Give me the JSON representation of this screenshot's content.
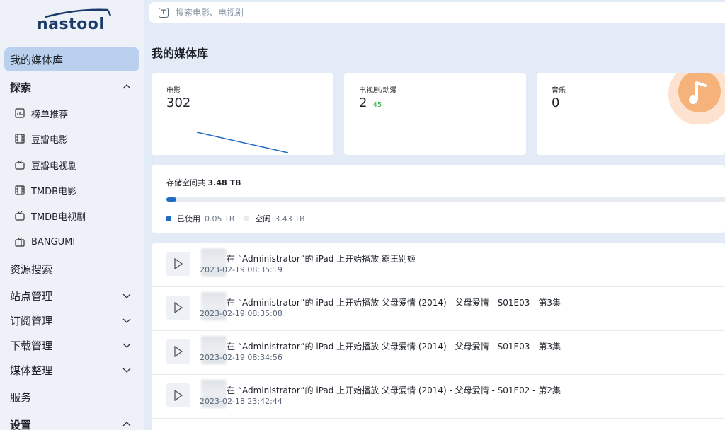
{
  "app": {
    "logo_text": "nastool"
  },
  "sidebar": {
    "items": [
      {
        "label": "我的媒体库",
        "active": true
      },
      {
        "label": "探索",
        "expanded": true
      },
      {
        "label": "资源搜索"
      },
      {
        "label": "站点管理"
      },
      {
        "label": "订阅管理"
      },
      {
        "label": "下载管理"
      },
      {
        "label": "媒体整理"
      },
      {
        "label": "服务"
      },
      {
        "label": "设置",
        "expanded": true
      }
    ],
    "explore_sub": [
      {
        "label": "榜单推荐",
        "icon": "chart-icon"
      },
      {
        "label": "豆瓣电影",
        "icon": "film-icon"
      },
      {
        "label": "豆瓣电视剧",
        "icon": "tv-icon"
      },
      {
        "label": "TMDB电影",
        "icon": "film-icon"
      },
      {
        "label": "TMDB电视剧",
        "icon": "tv-icon"
      },
      {
        "label": "BANGUMI",
        "icon": "tv-retro-icon"
      }
    ]
  },
  "search": {
    "placeholder": "搜索电影、电视剧",
    "icon_letter": "T"
  },
  "page": {
    "title": "我的媒体库"
  },
  "stats": {
    "movies": {
      "label": "电影",
      "value": "302"
    },
    "tv": {
      "label": "电视剧/动漫",
      "value": "2",
      "sub": "45"
    },
    "music": {
      "label": "音乐",
      "value": "0"
    }
  },
  "storage": {
    "title_prefix": "存储空间共",
    "total": "3.48 TB",
    "used_label": "已使用",
    "used": "0.05 TB",
    "free_label": "空闲",
    "free": "3.43 TB",
    "used_fraction": 0.0144,
    "colors": {
      "used": "#206bc4",
      "free": "#e8ebef"
    }
  },
  "activity": [
    {
      "title": "在 “Administrator”的 iPad 上开始播放 霸王别姬",
      "time": "2023-02-19 08:35:19"
    },
    {
      "title": "在 “Administrator”的 iPad 上开始播放 父母爱情 (2014) - 父母爱情 - S01E03 - 第3集",
      "time": "2023-02-19 08:35:08"
    },
    {
      "title": "在 “Administrator”的 iPad 上开始播放 父母爱情 (2014) - 父母爱情 - S01E03 - 第3集",
      "time": "2023-02-19 08:34:56"
    },
    {
      "title": "在 “Administrator”的 iPad 上开始播放 父母爱情 (2014) - 父母爱情 - S01E02 - 第2集",
      "time": "2023-02-18 23:42:44"
    }
  ],
  "colors": {
    "accent": "#206bc4",
    "active_nav": "#b9d0ee",
    "tv_sub": "#2fb344",
    "music_deco": "#f5b27a"
  }
}
